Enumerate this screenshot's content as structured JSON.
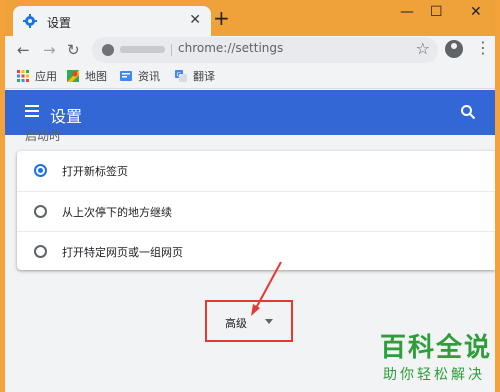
{
  "tab": {
    "title": "设置",
    "close": "✕"
  },
  "tabstrip": {
    "new_tab": "+",
    "minimize": "—",
    "maximize": "☐",
    "close": "✕"
  },
  "toolbar": {
    "back": "←",
    "forward": "→",
    "reload": "↻",
    "url_visible": "chrome://settings",
    "bookmark_star": "☆",
    "menu": "⋮"
  },
  "bookmarks": [
    {
      "label": "应用",
      "icon": "apps-grid-icon"
    },
    {
      "label": "地图",
      "icon": "maps-icon"
    },
    {
      "label": "资讯",
      "icon": "news-icon"
    },
    {
      "label": "翻译",
      "icon": "translate-icon"
    }
  ],
  "appbar": {
    "title": "设置"
  },
  "startup": {
    "heading_partial": "启动时",
    "options": [
      {
        "label": "打开新标签页",
        "selected": true
      },
      {
        "label": "从上次停下的地方继续",
        "selected": false
      },
      {
        "label": "打开特定网页或一组网页",
        "selected": false
      }
    ]
  },
  "advanced": {
    "label": "高级"
  },
  "watermark": {
    "line1": "百科全说",
    "line2": "助你轻松解决"
  },
  "colors": {
    "appbar": "#3367d6",
    "window_frame": "#f0a23a",
    "highlight_box": "#e53935",
    "radio_selected": "#1a73e8",
    "watermark": "#2e9d3a"
  }
}
